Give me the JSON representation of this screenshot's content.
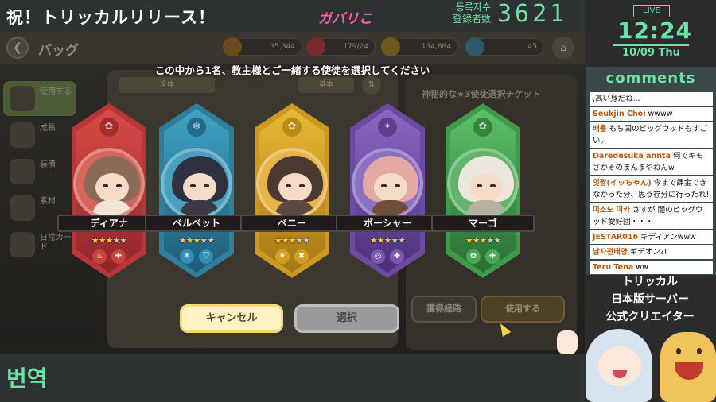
{
  "overlay": {
    "title": "祝！トリッカルリリース！",
    "logo": "ガバリこ",
    "reg_label_ko": "등록자수",
    "reg_label_ja": "登録者数",
    "reg_count": "3621",
    "translate_label": "번역",
    "live": "LIVE",
    "time": "12:24",
    "date": "10/09 Thu",
    "comments_title": "comments",
    "creator_lines": [
      "トリッカル",
      "日本版サーバー",
      "公式クリエイター"
    ]
  },
  "comments": [
    {
      "author": "",
      "text": ",高い身だね..."
    },
    {
      "author": "Seukjin Choi",
      "text": "wwww"
    },
    {
      "author": "배돌",
      "text": "もち国のビッグウッドもすごい。"
    },
    {
      "author": "Daredesuka annta",
      "text": "何でキモさがそのまんまやねんw"
    },
    {
      "author": "잇짱(イッちゃん)",
      "text": "今まで課金できなかった分、思う存分に行ったれ!"
    },
    {
      "author": "미소노 미카",
      "text": "さすが 闇のビッグウッド愛好団・・・"
    },
    {
      "author": "JESTAR016",
      "text": "キディアンwww"
    },
    {
      "author": "남자전태양",
      "text": "ギデオン?!"
    },
    {
      "author": "Teru Tena",
      "text": "ww"
    }
  ],
  "game": {
    "bag_title": "バッグ",
    "resources": [
      "35,344",
      "179/24",
      "134,884",
      "45"
    ],
    "sidebar": [
      {
        "label": "使用する"
      },
      {
        "label": "成長"
      },
      {
        "label": "装備"
      },
      {
        "label": "素材"
      },
      {
        "label": "日常カード"
      }
    ],
    "sort_left": "全体",
    "sort_right": "基本",
    "ticket_title": "神秘的な★3使徒選択チケット",
    "prompt": "この中から1名、教主様とご一緒する使徒を選択してください",
    "cards": [
      {
        "name": "ディアナ",
        "stars": 3,
        "color": "red",
        "skill_a": "♨",
        "skill_b": "✚"
      },
      {
        "name": "ベルベット",
        "stars": 3,
        "color": "blue",
        "skill_a": "❄",
        "skill_b": "⛉"
      },
      {
        "name": "ベニー",
        "stars": 3,
        "color": "yellow",
        "skill_a": "✷",
        "skill_b": "✖"
      },
      {
        "name": "ポーシャー",
        "stars": 3,
        "color": "purple",
        "skill_a": "◎",
        "skill_b": "✚"
      },
      {
        "name": "マーゴ",
        "stars": 3,
        "color": "green",
        "skill_a": "✿",
        "skill_b": "✚"
      }
    ],
    "cancel_label": "キャンセル",
    "select_label": "選択",
    "route_label": "獲得経路",
    "use_label": "使用する"
  }
}
